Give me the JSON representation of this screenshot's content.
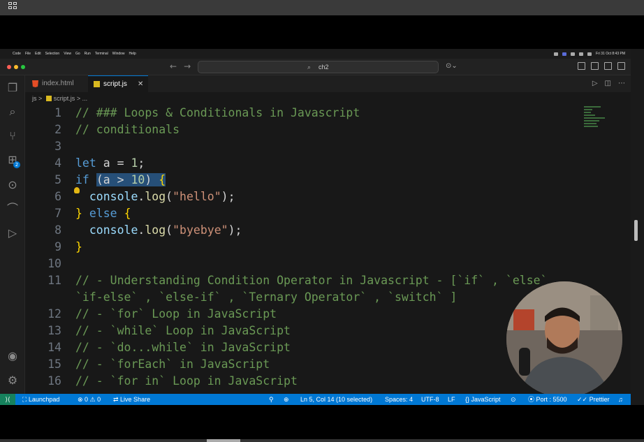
{
  "menubar": {
    "apple": "",
    "items": [
      "Code",
      "File",
      "Edit",
      "Selection",
      "View",
      "Go",
      "Run",
      "Terminal",
      "Window",
      "Help"
    ],
    "datetime": "Fri 31 Oct 8:43 PM"
  },
  "titlebar": {
    "search": "ch2",
    "back": "←",
    "forward": "→",
    "search_icon": "⌕",
    "copilot": "⊙⌄"
  },
  "tabs": [
    {
      "label": "index.html",
      "active": false
    },
    {
      "label": "script.js",
      "active": true,
      "close": "✕"
    }
  ],
  "tab_actions": [
    "▷",
    "◫",
    "⋯"
  ],
  "breadcrumb": {
    "folder": "js",
    "sep": ">",
    "file": "script.js",
    "more": "..."
  },
  "activity": {
    "badge": "2"
  },
  "code_lines": [
    {
      "n": "1",
      "t": "// ### Loops & Conditionals in Javascript"
    },
    {
      "n": "2",
      "t": "// conditionals"
    },
    {
      "n": "3",
      "t": ""
    },
    {
      "n": "4",
      "t": "let a = 1;"
    },
    {
      "n": "5",
      "t": "if (a > 10) {"
    },
    {
      "n": "6",
      "t": "  console.log(\"hello\");"
    },
    {
      "n": "7",
      "t": "} else {"
    },
    {
      "n": "8",
      "t": "  console.log(\"byebye\");"
    },
    {
      "n": "9",
      "t": "}"
    },
    {
      "n": "10",
      "t": ""
    },
    {
      "n": "11",
      "t": "// - Understanding Condition Operator in Javascript - [`if` , `else` ,"
    },
    {
      "n": "",
      "t": "`if-else` , `else-if` , `Ternary Operator` , `switch` ]"
    },
    {
      "n": "12",
      "t": "// - `for` Loop in JavaScript"
    },
    {
      "n": "13",
      "t": "// - `while` Loop in JavaScript"
    },
    {
      "n": "14",
      "t": "// - `do...while` in JavaScript"
    },
    {
      "n": "15",
      "t": "// - `forEach` in JavaScript"
    },
    {
      "n": "16",
      "t": "// - `for in` Loop in JavaScript"
    }
  ],
  "statusbar": {
    "remote": "⟩⟨",
    "launchpad": "Launchpad",
    "problems": "⊗ 0 ⚠ 0",
    "liveshare": "Live Share",
    "cursor": "Ln 5, Col 14 (10 selected)",
    "spaces": "Spaces: 4",
    "encoding": "UTF-8",
    "eol": "LF",
    "language": "JavaScript",
    "port": "Port : 5500",
    "prettier": "Prettier"
  },
  "colors": {
    "accent": "#0078d4",
    "remote": "#16825d",
    "comment": "#6a9955",
    "keyword": "#569cd6"
  }
}
